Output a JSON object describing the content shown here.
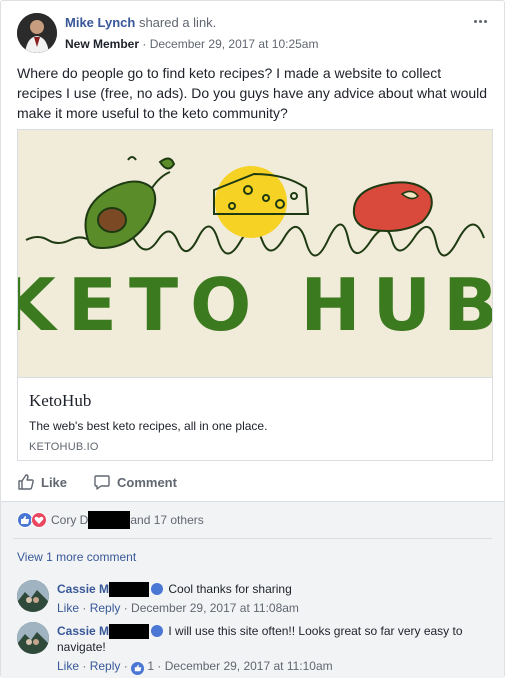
{
  "post": {
    "author": "Mike Lynch",
    "shared_text": "shared a",
    "shared_link": "link.",
    "member_badge": "New Member",
    "separator": " · ",
    "timestamp": "December 29, 2017 at 10:25am",
    "text": "Where do people go to find keto recipes? I made a website to collect recipes I use (free, no ads). Do you guys have any advice about what would make it more useful to the keto community?"
  },
  "link_preview": {
    "image_text": "KETO HUB",
    "title": "KetoHub",
    "description": "The web's best keto recipes, all in one place.",
    "domain": "KETOHUB.IO"
  },
  "actions": {
    "like_label": "Like",
    "comment_label": "Comment"
  },
  "reactions": {
    "name_start": "Cory D",
    "others_text": "and 17 others"
  },
  "view_more_comments": "View 1 more comment",
  "comments": [
    {
      "name_start": "Cassie M",
      "text": "Cool thanks for sharing",
      "like": "Like",
      "reply": "Reply",
      "sep": " · ",
      "timestamp": "December 29, 2017 at 11:08am"
    },
    {
      "name_start": "Cassie M",
      "text": "I will use this site often!! Looks great so far very easy to navigate!",
      "like": "Like",
      "reply": "Reply",
      "sep": " · ",
      "reaction_count": "1",
      "timestamp": "December 29, 2017 at 11:10am"
    }
  ],
  "colors": {
    "link_blue": "#385898",
    "meta_gray": "#616770",
    "keto_green": "#3b7a1e",
    "cheese_yellow": "#f5d224",
    "steak_red": "#d94a3c"
  }
}
